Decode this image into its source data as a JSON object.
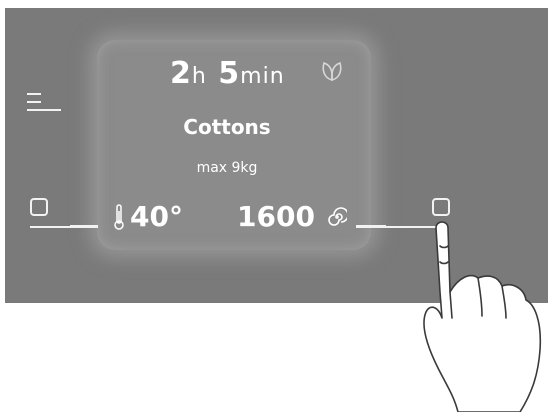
{
  "display": {
    "time_hours": "2",
    "time_hours_unit": "h",
    "time_minutes": "5",
    "time_minutes_unit": "min",
    "program": "Cottons",
    "load": "max 9kg",
    "temperature": "40°",
    "spin_speed": "1600"
  },
  "icons": {
    "menu": "menu-icon",
    "eco": "leaf-icon",
    "temperature": "thermometer-icon",
    "spin": "spin-icon",
    "left_button": "square-button-icon",
    "right_button": "square-button-icon",
    "hand": "pointing-hand-icon"
  },
  "colors": {
    "panel": "#7a7a7a",
    "screen": "#8b8b8b",
    "text": "#ffffff"
  }
}
